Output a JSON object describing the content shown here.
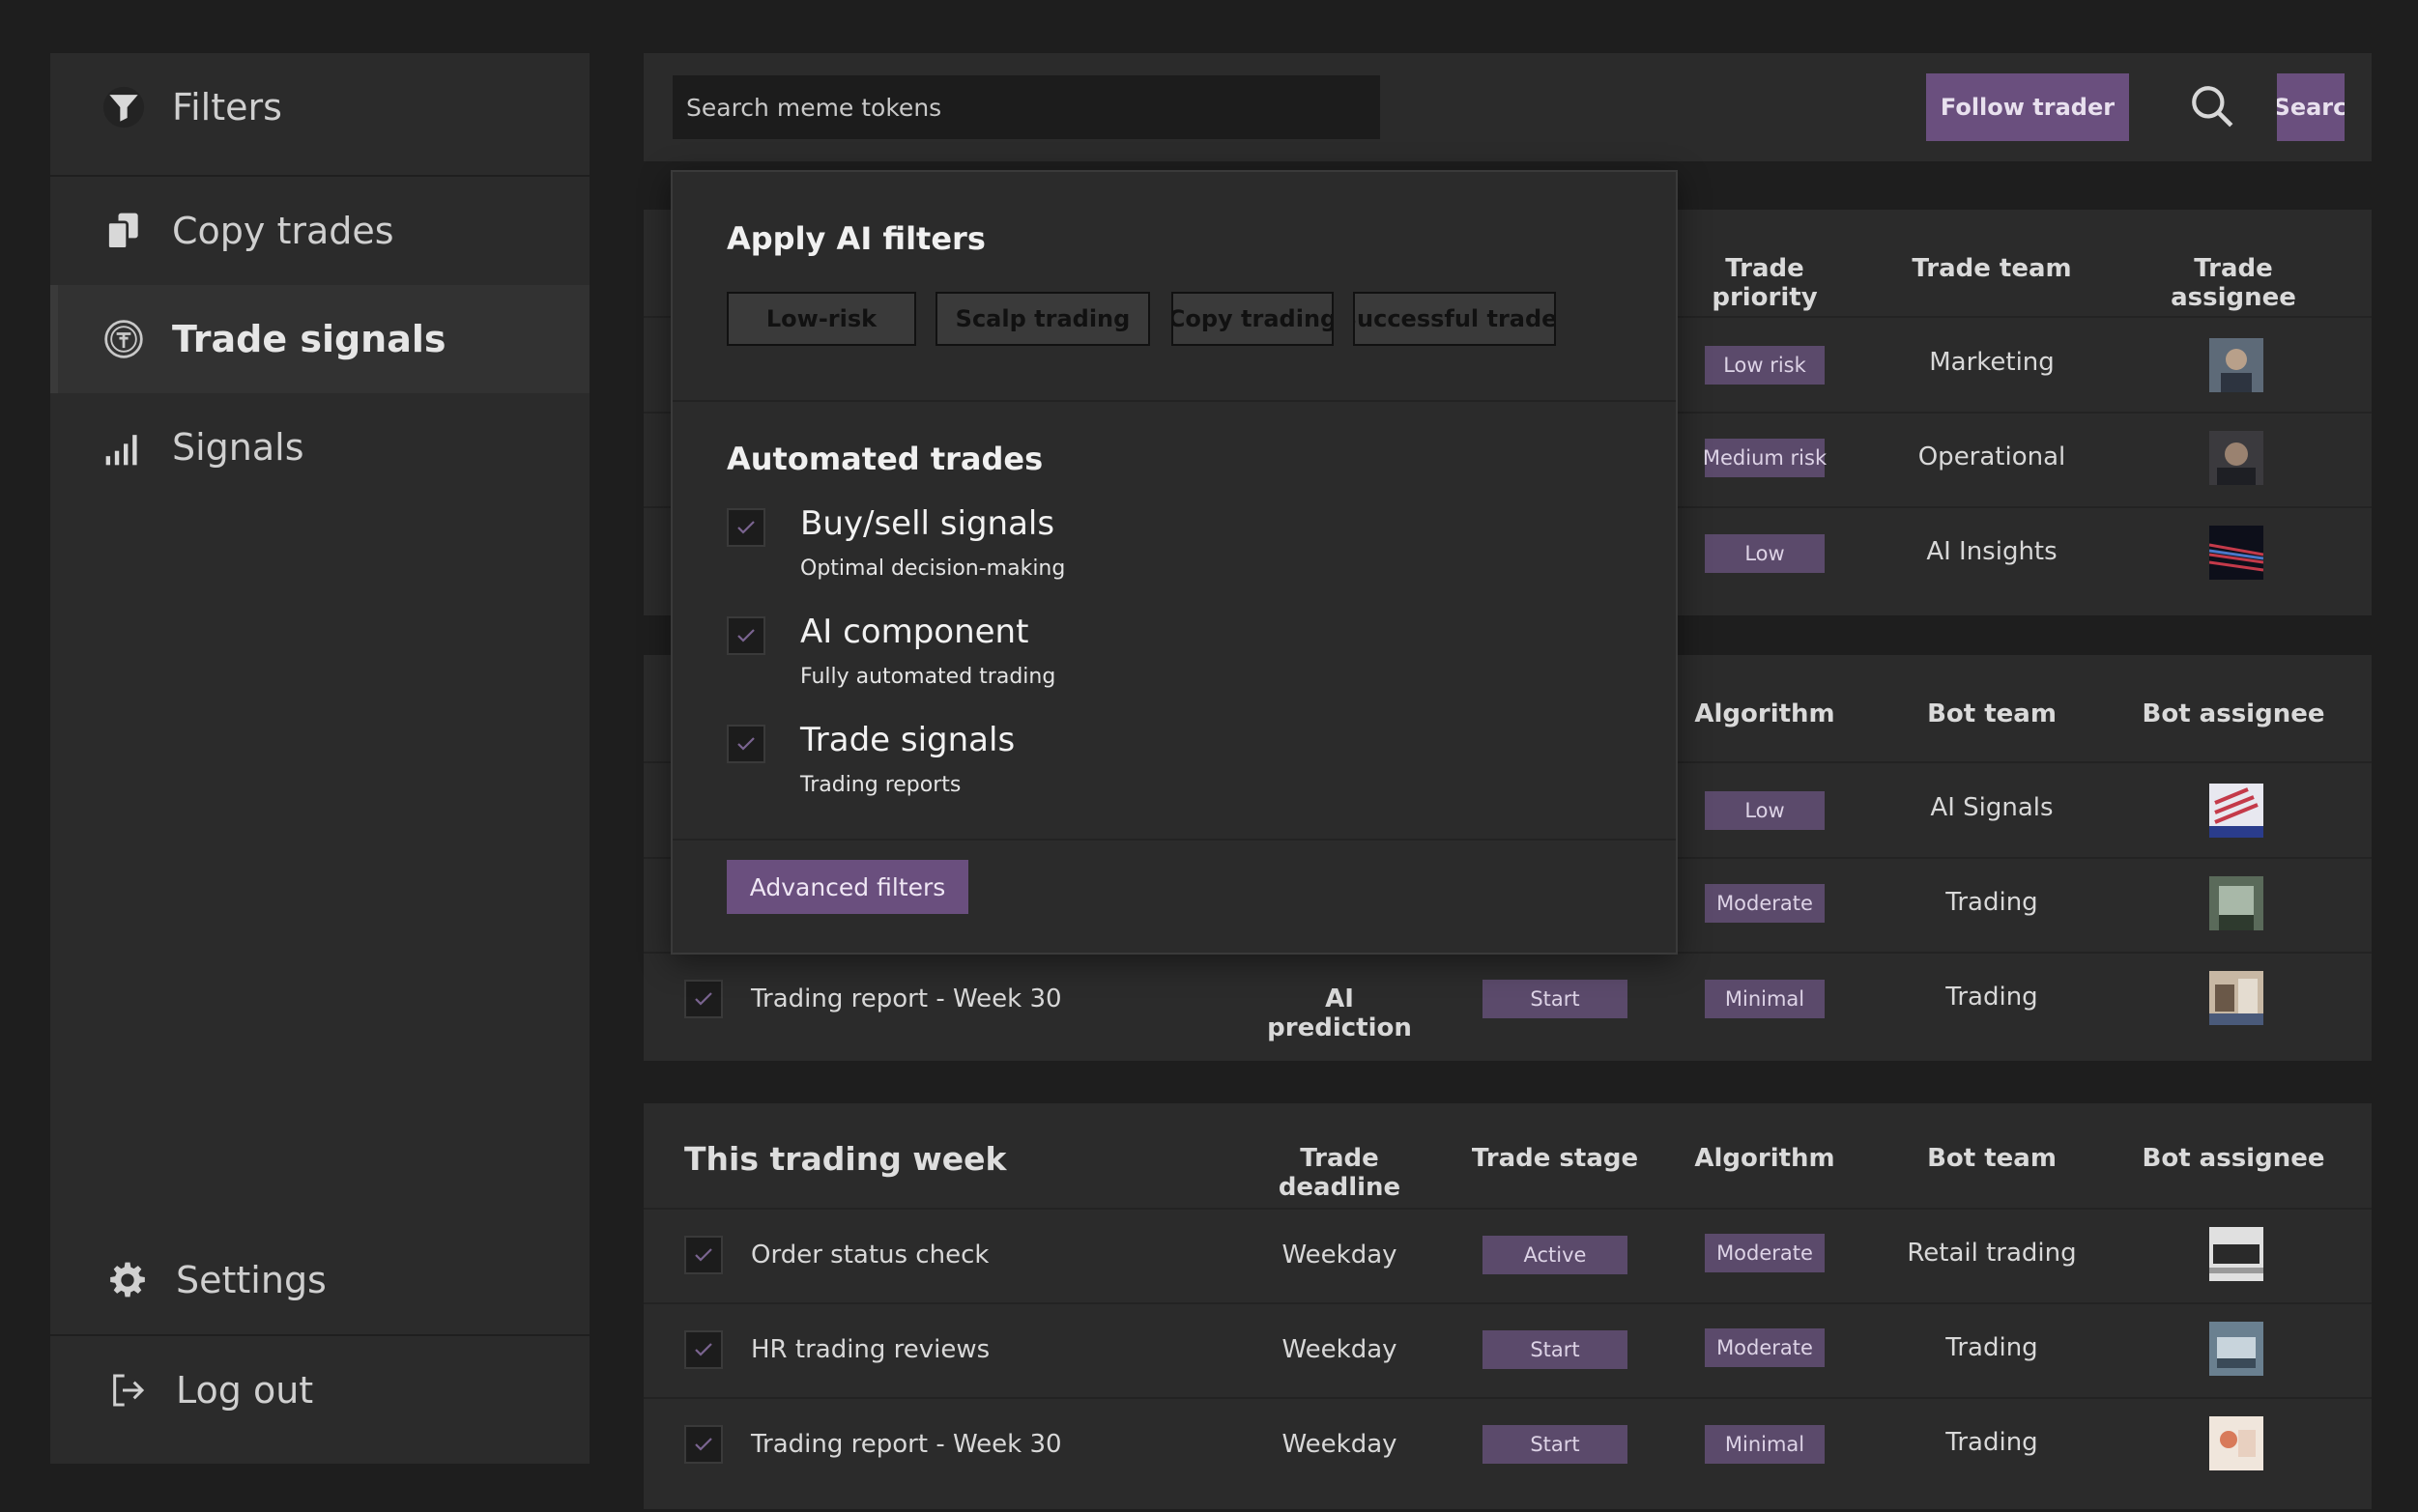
{
  "sidebar": {
    "items": [
      {
        "label": "Filters"
      },
      {
        "label": "Copy trades"
      },
      {
        "label": "Trade signals"
      },
      {
        "label": "Signals"
      }
    ],
    "bottom": [
      {
        "label": "Settings"
      },
      {
        "label": "Log out"
      }
    ]
  },
  "topbar": {
    "search_placeholder": "Search meme tokens",
    "follow_label": "Follow trader",
    "search_label": "Search"
  },
  "panel1": {
    "headers": {
      "priority": "Trade priority",
      "team": "Trade team",
      "assignee": "Trade assignee"
    },
    "rows": [
      {
        "priority": "Low risk",
        "team": "Marketing"
      },
      {
        "priority": "Medium risk",
        "team": "Operational"
      },
      {
        "priority": "Low",
        "team": "AI Insights"
      }
    ]
  },
  "panel2": {
    "headers": {
      "algorithm": "Algorithm",
      "team": "Bot team",
      "assignee": "Bot assignee"
    },
    "rows": [
      {
        "algorithm": "Low",
        "team": "AI Signals"
      },
      {
        "algorithm": "Moderate",
        "team": "Trading"
      },
      {
        "name": "Trading report - Week 30",
        "deadline": "AI prediction",
        "stage": "Start",
        "algorithm": "Minimal",
        "team": "Trading"
      }
    ]
  },
  "panel3": {
    "title": "This trading week",
    "headers": {
      "deadline": "Trade deadline",
      "stage": "Trade stage",
      "algorithm": "Algorithm",
      "team": "Bot team",
      "assignee": "Bot assignee"
    },
    "rows": [
      {
        "name": "Order status check",
        "deadline": "Weekday",
        "stage": "Active",
        "algorithm": "Moderate",
        "team": "Retail trading"
      },
      {
        "name": "HR trading reviews",
        "deadline": "Weekday",
        "stage": "Start",
        "algorithm": "Moderate",
        "team": "Trading"
      },
      {
        "name": "Trading report - Week 30",
        "deadline": "Weekday",
        "stage": "Start",
        "algorithm": "Minimal",
        "team": "Trading"
      }
    ]
  },
  "popover": {
    "title": "Apply AI filters",
    "tags": [
      "Low-risk",
      "Scalp trading",
      "Copy trading",
      "Successful trader"
    ],
    "section_title": "Automated trades",
    "options": [
      {
        "title": "Buy/sell signals",
        "sub": "Optimal decision-making"
      },
      {
        "title": "AI component",
        "sub": "Fully automated trading"
      },
      {
        "title": "Trade signals",
        "sub": "Trading reports"
      }
    ],
    "advanced_label": "Advanced filters"
  },
  "colors": {
    "accent": "#6a4f7e",
    "chip": "#5b4a6b",
    "panel": "#2b2b2b",
    "background": "#1e1e1e"
  }
}
